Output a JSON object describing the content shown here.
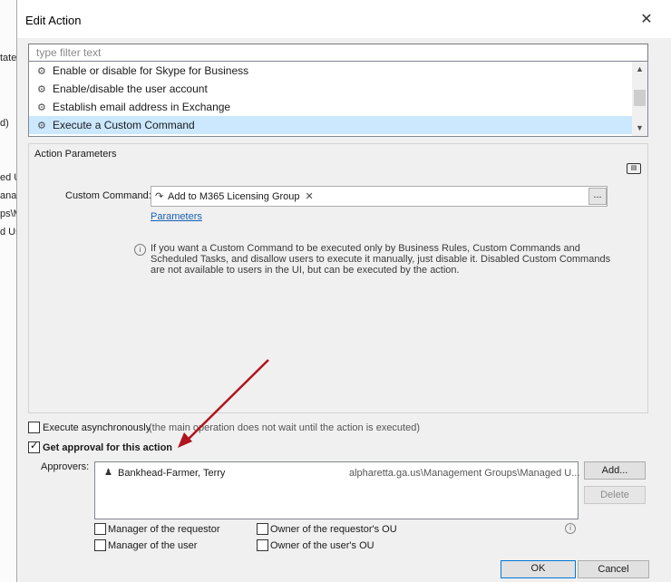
{
  "background": {
    "fragments": [
      "tate",
      "d)",
      "ed U",
      "anag",
      "ps\\M",
      "d Us"
    ]
  },
  "dialog": {
    "title": "Edit Action",
    "close_glyph": "✕"
  },
  "filter": {
    "placeholder": "type filter text",
    "value": ""
  },
  "action_list": {
    "items": [
      {
        "label": "Enable or disable for Skype for Business",
        "icon": "gear-icon",
        "selected": false
      },
      {
        "label": "Enable/disable the user account",
        "icon": "gear-icon",
        "selected": false
      },
      {
        "label": "Establish email address in Exchange",
        "icon": "gear-icon",
        "selected": false
      },
      {
        "label": "Execute a Custom Command",
        "icon": "gear-icon",
        "selected": true
      }
    ]
  },
  "action_parameters": {
    "title": "Action Parameters",
    "custom_command_label": "Custom Command:",
    "custom_command_value": "Add to M365 Licensing Group",
    "ellipsis_label": "...",
    "parameters_link": "Parameters",
    "info_text": "If you want a Custom Command to be executed only by Business Rules, Custom Commands and Scheduled Tasks, and disallow users to execute it manually, just disable it. Disabled Custom Commands are not available to users in the UI, but can be executed by the action."
  },
  "options": {
    "execute_async_label": "Execute asynchronously",
    "execute_async_note": "(the main operation does not wait until the action is executed)",
    "execute_async_checked": false,
    "get_approval_label": "Get approval for this action",
    "get_approval_checked": true
  },
  "approvers": {
    "label": "Approvers:",
    "rows": [
      {
        "name": "Bankhead-Farmer, Terry",
        "path": "alpharetta.ga.us\\Management Groups\\Managed U..."
      }
    ],
    "add_label": "Add...",
    "delete_label": "Delete"
  },
  "approver_options": {
    "manager_requestor": {
      "label": "Manager of the requestor",
      "checked": false
    },
    "owner_requestor_ou": {
      "label": "Owner of the requestor's OU",
      "checked": false
    },
    "manager_user": {
      "label": "Manager of the user",
      "checked": false
    },
    "owner_user_ou": {
      "label": "Owner of the user's OU",
      "checked": false
    }
  },
  "footer": {
    "ok_label": "OK",
    "cancel_label": "Cancel"
  },
  "colors": {
    "selection": "#cce8ff",
    "link": "#1a5fb4",
    "annotation_arrow": "#b0141c"
  }
}
